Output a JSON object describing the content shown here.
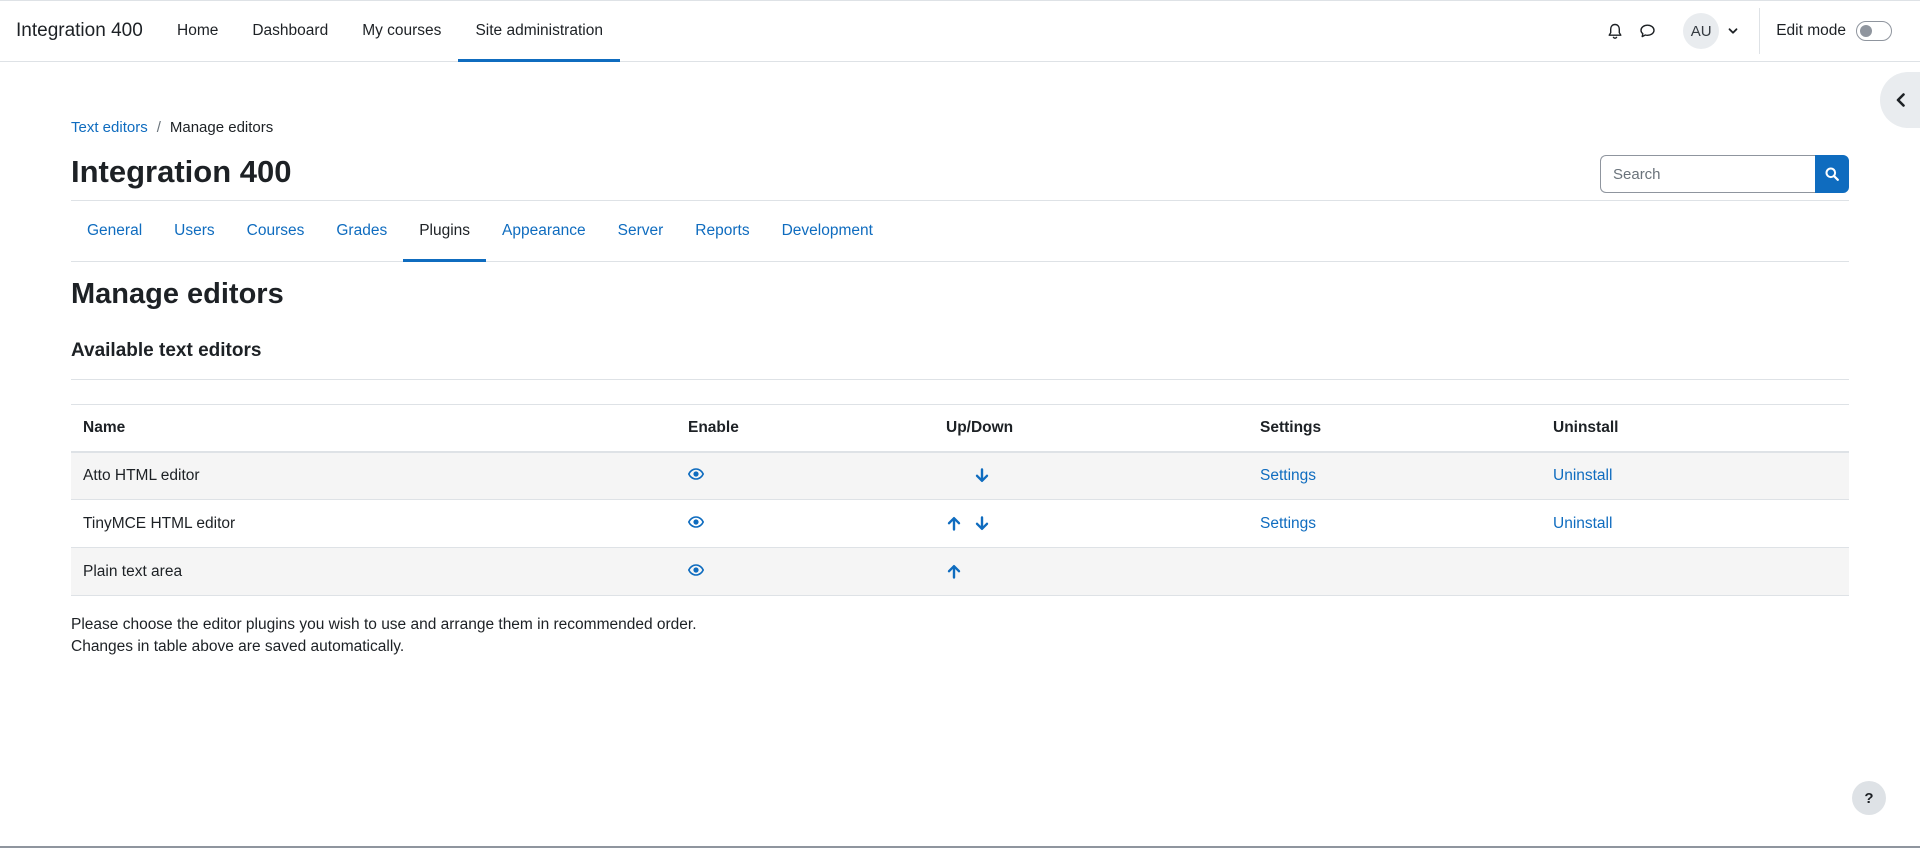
{
  "site": {
    "brand": "Integration 400"
  },
  "primary_nav": [
    {
      "label": "Home",
      "active": false
    },
    {
      "label": "Dashboard",
      "active": false
    },
    {
      "label": "My courses",
      "active": false
    },
    {
      "label": "Site administration",
      "active": true
    }
  ],
  "user_menu": {
    "initials": "AU",
    "edit_mode_label": "Edit mode",
    "edit_mode_on": false
  },
  "icons": {
    "notifications": "bell-icon",
    "messages": "chat-bubble-icon",
    "user_menu_caret": "chevron-down-icon",
    "drawer": "chevron-left-icon",
    "search": "search-icon",
    "enable": "eye-icon",
    "up": "arrow-up-icon",
    "down": "arrow-down-icon"
  },
  "breadcrumb": [
    {
      "label": "Text editors",
      "link": true
    },
    {
      "label": "Manage editors",
      "link": false
    }
  ],
  "header": {
    "title": "Integration 400"
  },
  "search": {
    "placeholder": "Search"
  },
  "admin_tabs": [
    {
      "label": "General",
      "active": false
    },
    {
      "label": "Users",
      "active": false
    },
    {
      "label": "Courses",
      "active": false
    },
    {
      "label": "Grades",
      "active": false
    },
    {
      "label": "Plugins",
      "active": true
    },
    {
      "label": "Appearance",
      "active": false
    },
    {
      "label": "Server",
      "active": false
    },
    {
      "label": "Reports",
      "active": false
    },
    {
      "label": "Development",
      "active": false
    }
  ],
  "main": {
    "heading": "Manage editors",
    "subheading": "Available text editors"
  },
  "table": {
    "headers": {
      "name": "Name",
      "enable": "Enable",
      "updown": "Up/Down",
      "settings": "Settings",
      "uninstall": "Uninstall"
    },
    "rows": [
      {
        "name": "Atto HTML editor",
        "up": false,
        "down": true,
        "settings": "Settings",
        "uninstall": "Uninstall"
      },
      {
        "name": "TinyMCE HTML editor",
        "up": true,
        "down": true,
        "settings": "Settings",
        "uninstall": "Uninstall"
      },
      {
        "name": "Plain text area",
        "up": true,
        "down": false,
        "settings": "",
        "uninstall": ""
      }
    ]
  },
  "footnote": {
    "line1": "Please choose the editor plugins you wish to use and arrange them in recommended order.",
    "line2": "Changes in table above are saved automatically."
  },
  "help": {
    "label": "?"
  },
  "colors": {
    "link": "#0f6cbf",
    "text": "#1d2125",
    "border": "#dee2e6",
    "stripe": "#f5f5f5"
  }
}
